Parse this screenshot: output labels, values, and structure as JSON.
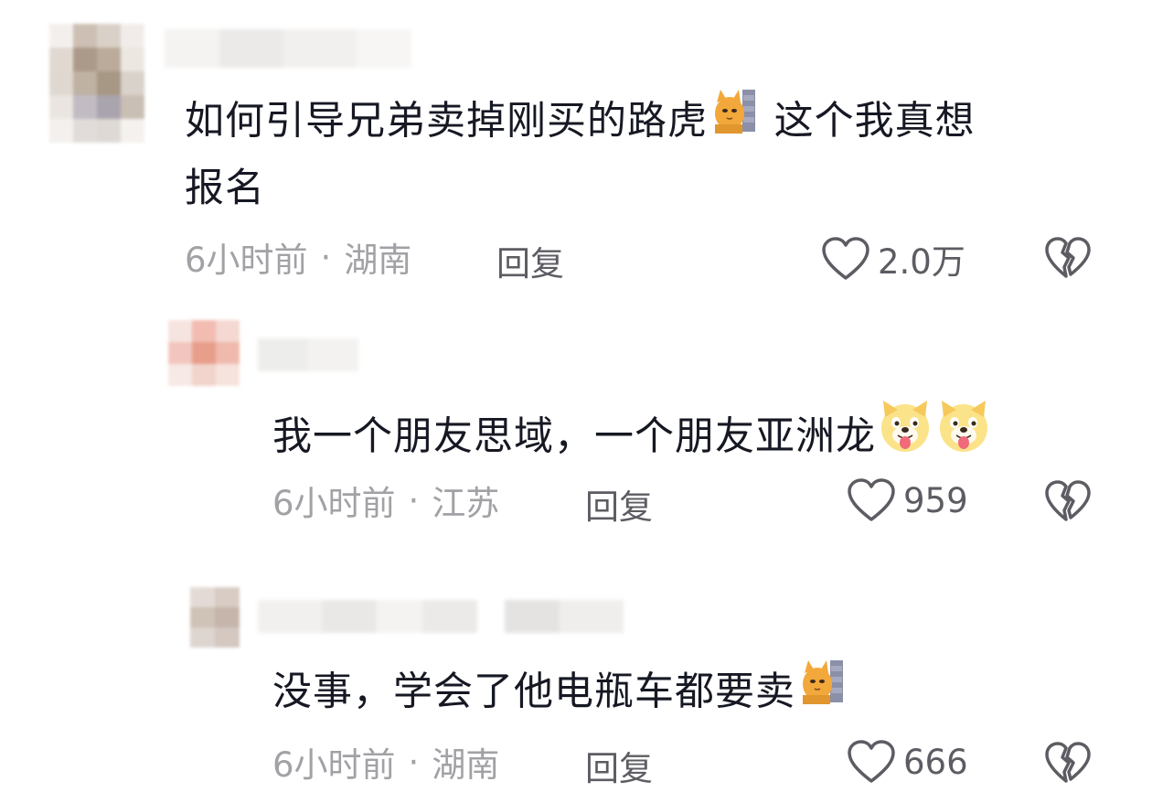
{
  "comments": [
    {
      "text_before": "如何引导兄弟卖掉刚买的路虎",
      "emoji_after": "cat-peek-emoji",
      "text_after": " 这个我真想",
      "text_line2": "报名",
      "time": "6小时前",
      "separator": "·",
      "location": "湖南",
      "reply_label": "回复",
      "likes": "2.0万"
    },
    {
      "text_before": "我一个朋友思域，一个朋友亚洲龙",
      "emoji_after": "dog-tongue-emoji",
      "time": "6小时前",
      "separator": "·",
      "location": "江苏",
      "reply_label": "回复",
      "likes": "959"
    },
    {
      "text_before": "没事，学会了他电瓶车都要卖",
      "emoji_after": "cat-peek-emoji",
      "time": "6小时前",
      "separator": "·",
      "location": "湖南",
      "reply_label": "回复",
      "likes": "666"
    }
  ],
  "icons": {
    "like": "heart-outline-icon",
    "dislike": "broken-heart-icon"
  },
  "colors": {
    "text": "#161823",
    "meta": "#a1a1a6",
    "action": "#5c5c63"
  }
}
